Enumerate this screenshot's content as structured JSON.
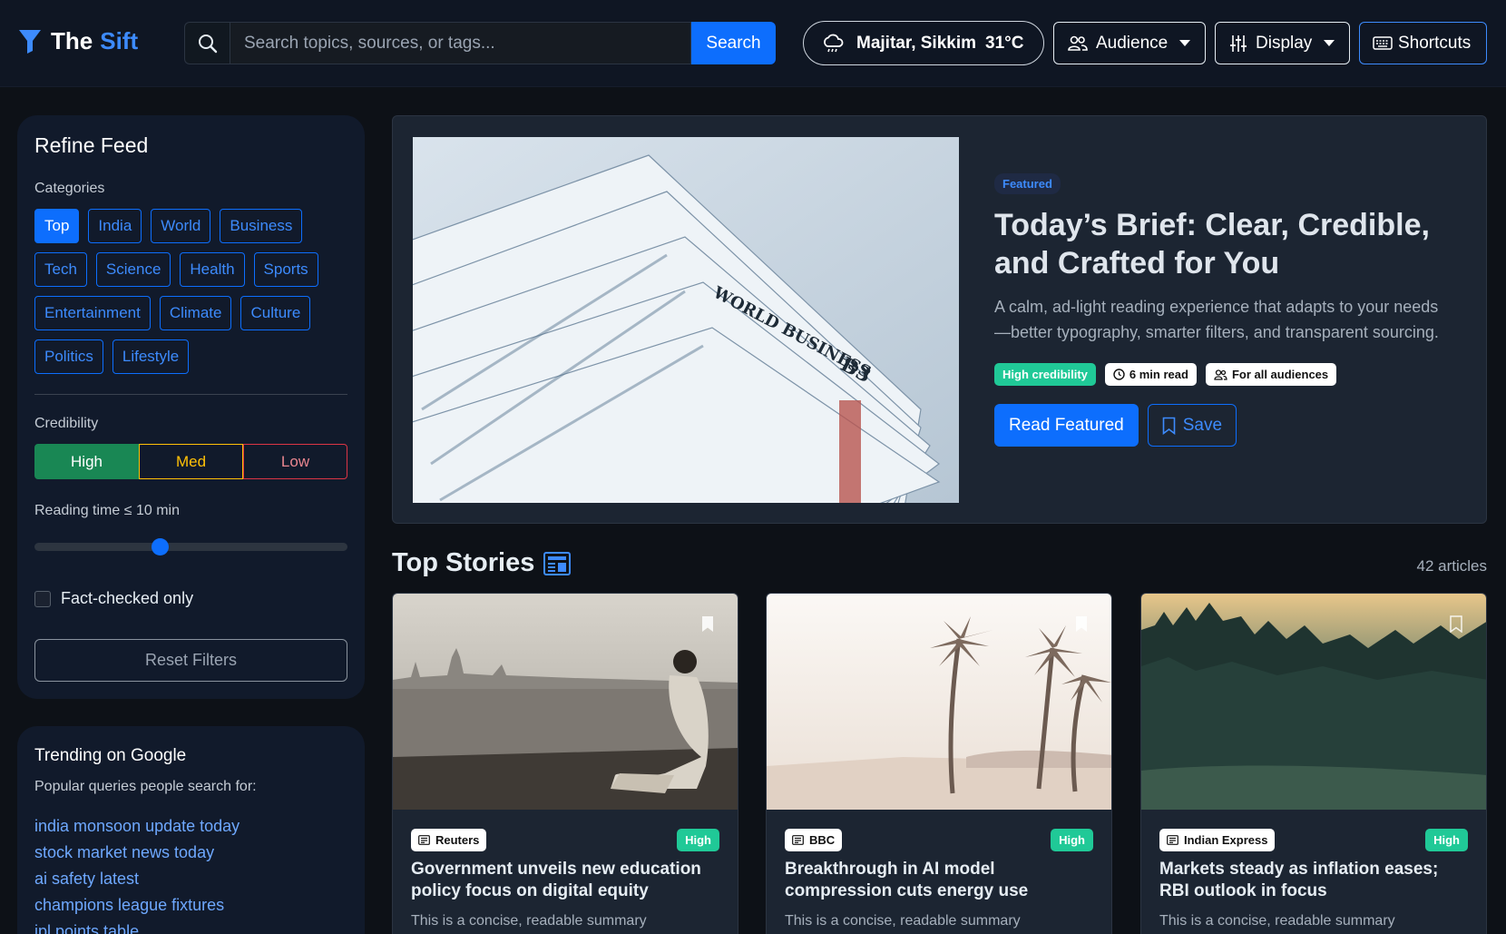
{
  "brand": {
    "the": "The",
    "sift": "Sift"
  },
  "search": {
    "placeholder": "Search topics, sources, or tags...",
    "button": "Search"
  },
  "weather": {
    "location": "Majitar, Sikkim",
    "temp": "31°C"
  },
  "nav": {
    "audience": "Audience",
    "display": "Display",
    "shortcuts": "Shortcuts"
  },
  "filters": {
    "title": "Refine Feed",
    "categories_label": "Categories",
    "categories": [
      "Top",
      "India",
      "World",
      "Business",
      "Tech",
      "Science",
      "Health",
      "Sports",
      "Entertainment",
      "Climate",
      "Culture",
      "Politics",
      "Lifestyle"
    ],
    "active_category": "Top",
    "credibility_label": "Credibility",
    "cred_high": "High",
    "cred_med": "Med",
    "cred_low": "Low",
    "reading_label": "Reading time ≤ 10 min",
    "reading_value": 10,
    "reading_max": 25,
    "fact_checked": "Fact-checked only",
    "reset": "Reset Filters"
  },
  "trending": {
    "title": "Trending on Google",
    "subtitle": "Popular queries people search for:",
    "items": [
      "india monsoon update today",
      "stock market news today",
      "ai safety latest",
      "champions league fixtures",
      "ipl points table"
    ]
  },
  "hero": {
    "badge": "Featured",
    "title": "Today’s Brief: Clear, Credible, and Crafted for You",
    "desc": "A calm, ad-light reading experience that adapts to your needs—better typography, smarter filters, and transparent sourcing.",
    "cred": "High credibility",
    "read_time": "6 min read",
    "audience": "For all audiences",
    "read_btn": "Read Featured",
    "save_btn": "Save"
  },
  "top_stories": {
    "title": "Top Stories",
    "count": "42 articles",
    "cards": [
      {
        "source": "Reuters",
        "level": "High",
        "title": "Government unveils new education policy focus on digital equity",
        "summary": "This is a concise, readable summary"
      },
      {
        "source": "BBC",
        "level": "High",
        "title": "Breakthrough in AI model compression cuts energy use",
        "summary": "This is a concise, readable summary"
      },
      {
        "source": "Indian Express",
        "level": "High",
        "title": "Markets steady as inflation eases; RBI outlook in focus",
        "summary": "This is a concise, readable summary"
      }
    ]
  },
  "colors": {
    "accent": "#0d6efd",
    "success": "#198754",
    "warning": "#ffc107",
    "danger": "#dc3545",
    "teal": "#20c997"
  },
  "icons": [
    "funnel-icon",
    "search-icon",
    "cloud-rain-icon",
    "people-icon",
    "sliders-icon",
    "keyboard-icon",
    "clock-icon",
    "bookmark-icon",
    "newspaper-icon"
  ]
}
